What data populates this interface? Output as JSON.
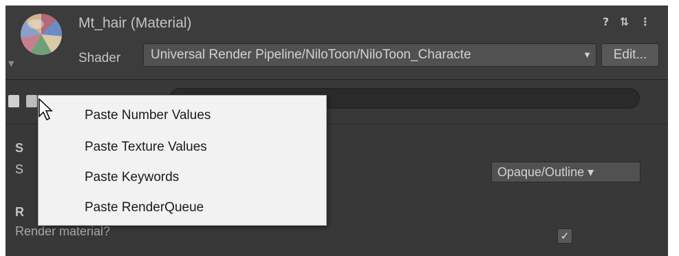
{
  "header": {
    "title": "Mt_hair (Material)",
    "help_icon": "?",
    "settings_icon": "⇅",
    "menu_icon": "⋮",
    "foldout_icon": "▼"
  },
  "shader": {
    "label": "Shader",
    "value": "Universal Render Pipeline/NiloToon/NiloToon_Characte",
    "dropdown_arrow": "▼",
    "edit_label": "Edit..."
  },
  "toolbar": {
    "search_placeholder": ""
  },
  "properties": {
    "section_1_letter": "S",
    "row_1_letter": "S",
    "surface_dropdown_value": "Opaque/Outline ▾",
    "section_2_letter": "R",
    "render_material_label": "Render material?",
    "render_material_checked": "✓"
  },
  "context_menu": {
    "items": [
      {
        "label": "Paste Number Values"
      },
      {
        "label": "Paste Texture Values"
      },
      {
        "label": "Paste Keywords"
      },
      {
        "label": "Paste RenderQueue"
      }
    ]
  },
  "colors": {
    "panel_bg": "#383838",
    "header_bg": "#3c3c3c",
    "menu_bg": "#f2f2f2"
  }
}
